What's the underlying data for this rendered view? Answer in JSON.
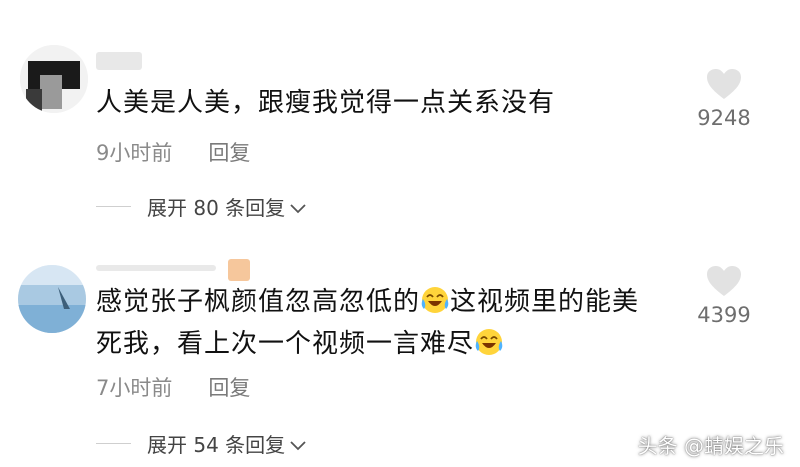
{
  "comments": [
    {
      "text": "人美是人美，跟瘦我觉得一点关系没有",
      "time": "9小时前",
      "reply_label": "回复",
      "expand_label": "展开 80 条回复",
      "like_count": "9248"
    },
    {
      "text_part1": "感觉张子枫颜值忽高忽低的",
      "text_part2": "这视频里的能美死我，看上次一个视频一言难尽",
      "time": "7小时前",
      "reply_label": "回复",
      "expand_label": "展开 54 条回复",
      "like_count": "4399"
    }
  ],
  "watermark": "头条 @蜻娱之乐",
  "icons": {
    "like": "heart-icon",
    "expand": "chevron-down-icon",
    "emoji": "laughing-crying-emoji-icon"
  }
}
